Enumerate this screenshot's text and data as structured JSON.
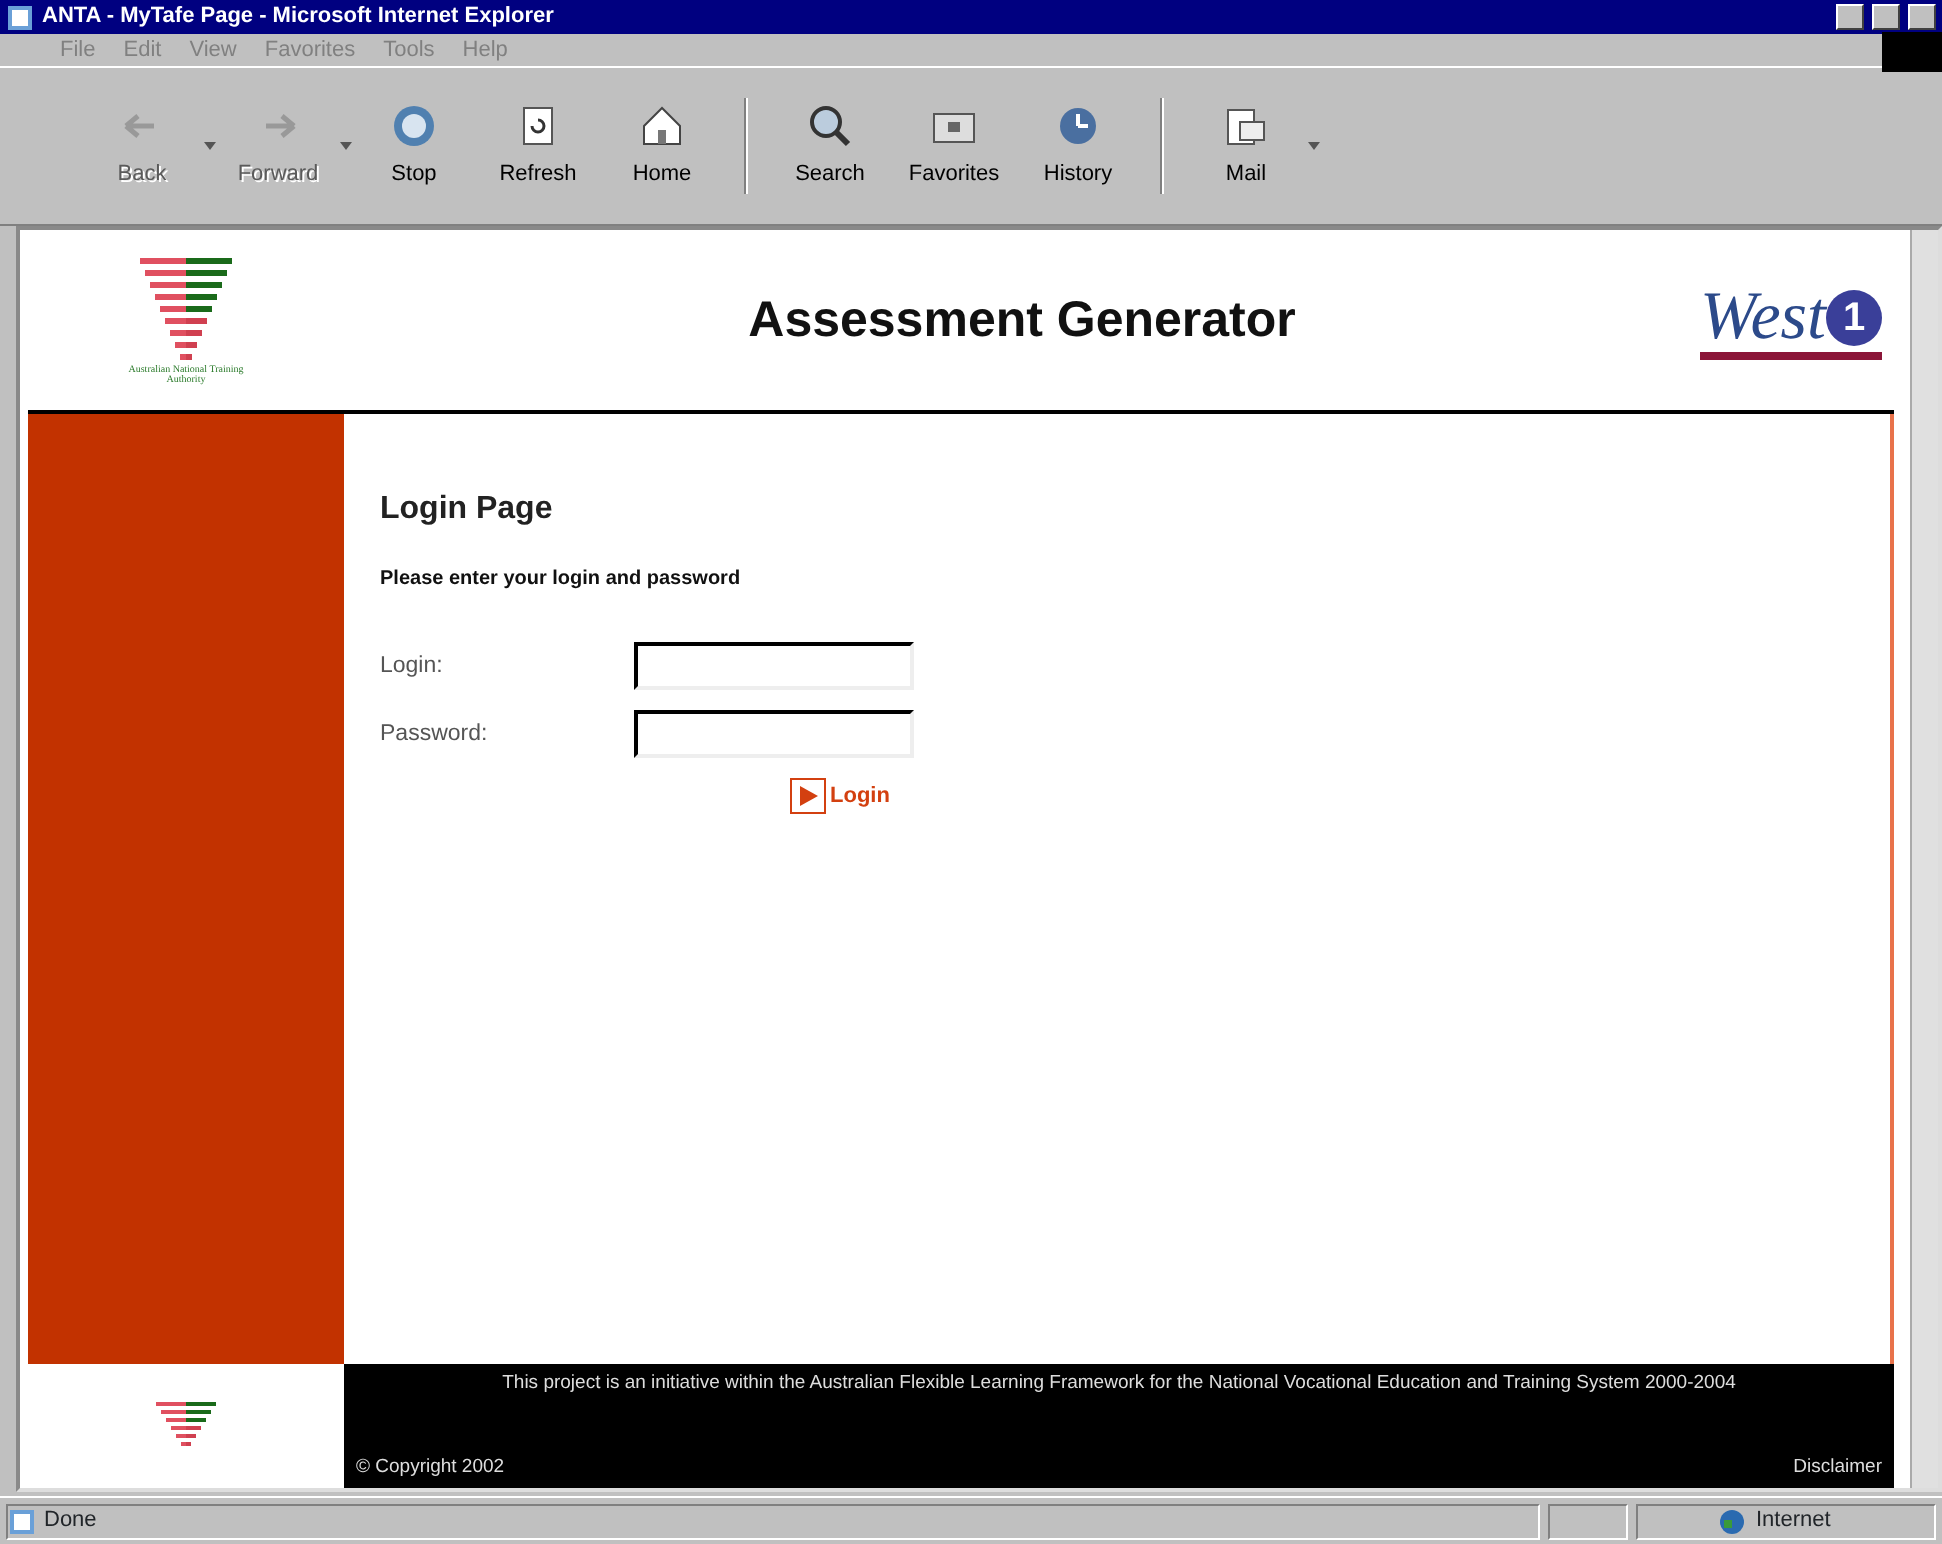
{
  "window": {
    "title": "ANTA - MyTafe Page - Microsoft Internet Explorer"
  },
  "menu": [
    "File",
    "Edit",
    "View",
    "Favorites",
    "Tools",
    "Help"
  ],
  "toolbar": [
    {
      "label": "Back",
      "kind": "back",
      "disabled": true,
      "dropdown": true
    },
    {
      "label": "Forward",
      "kind": "forward",
      "disabled": true,
      "dropdown": true
    },
    {
      "label": "Stop",
      "kind": "stop",
      "disabled": false,
      "dropdown": false
    },
    {
      "label": "Refresh",
      "kind": "refresh",
      "disabled": false,
      "dropdown": false
    },
    {
      "label": "Home",
      "kind": "home",
      "disabled": false,
      "dropdown": false
    },
    {
      "label": "Search",
      "kind": "search",
      "disabled": false,
      "dropdown": false,
      "separator_before": true
    },
    {
      "label": "Favorites",
      "kind": "favorites",
      "disabled": false,
      "dropdown": false
    },
    {
      "label": "History",
      "kind": "history",
      "disabled": false,
      "dropdown": false
    },
    {
      "label": "Mail",
      "kind": "mail",
      "disabled": false,
      "dropdown": true,
      "separator_before": true
    }
  ],
  "header": {
    "logo_text": "Australian National Training Authority",
    "title": "Assessment Generator",
    "brand": "West",
    "brand_badge": "1"
  },
  "login": {
    "heading": "Login Page",
    "instruction": "Please enter your login and password",
    "fields": [
      {
        "label": "Login:"
      },
      {
        "label": "Password:"
      }
    ],
    "submit": "Login"
  },
  "footer": {
    "notice": "This project is an initiative within the Australian Flexible Learning Framework for the National Vocational Education and Training System 2000-2004",
    "copyright": "© Copyright 2002",
    "link": "Disclaimer"
  },
  "status_bar": {
    "text": "Done",
    "zone": "Internet"
  }
}
